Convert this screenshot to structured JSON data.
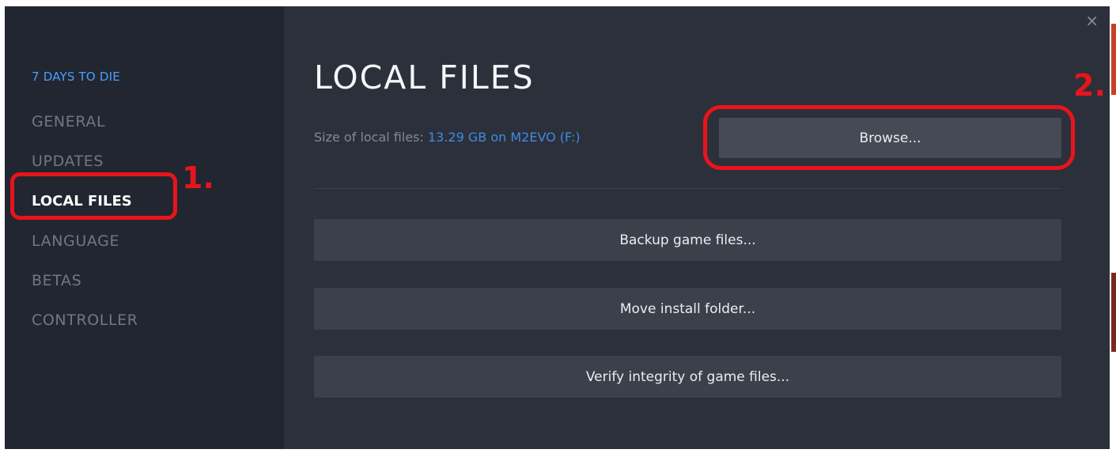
{
  "window": {
    "close_glyph": "×"
  },
  "sidebar": {
    "game_title": "7 DAYS TO DIE",
    "items": [
      {
        "label": "GENERAL",
        "active": false
      },
      {
        "label": "UPDATES",
        "active": false
      },
      {
        "label": "LOCAL FILES",
        "active": true
      },
      {
        "label": "LANGUAGE",
        "active": false
      },
      {
        "label": "BETAS",
        "active": false
      },
      {
        "label": "CONTROLLER",
        "active": false
      }
    ]
  },
  "main": {
    "title": "LOCAL FILES",
    "size_label": "Size of local files: ",
    "size_value": "13.29 GB on M2EVO (F:)",
    "browse_label": "Browse...",
    "buttons": [
      {
        "label": "Backup game files..."
      },
      {
        "label": "Move install folder..."
      },
      {
        "label": "Verify integrity of game files..."
      }
    ]
  },
  "annotations": {
    "step_1": "1.",
    "step_2": "2."
  },
  "colors": {
    "window_bg": "#2c303a",
    "sidebar_bg": "#222630",
    "accent_blue": "#4a9eff",
    "button_bg": "#3c404b",
    "annotation_red": "#e8141c"
  }
}
